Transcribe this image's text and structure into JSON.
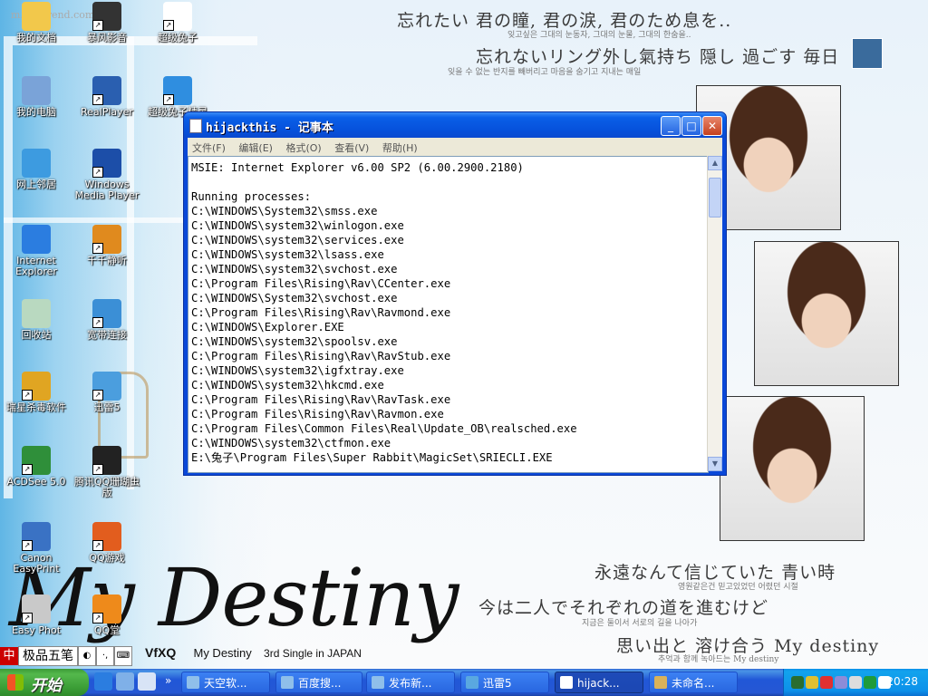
{
  "desktop": {
    "icons": [
      {
        "label": "我的文档",
        "glyph": "my-documents-icon",
        "color": "#f2c84b",
        "shortcut": false
      },
      {
        "label": "暴风影音",
        "glyph": "baofeng-player-icon",
        "color": "#333333",
        "shortcut": true
      },
      {
        "label": "超级兔子",
        "glyph": "super-rabbit-icon",
        "color": "#ffffff",
        "shortcut": true
      },
      {
        "label": "我的电脑",
        "glyph": "my-computer-icon",
        "color": "#7aa3d8",
        "shortcut": false
      },
      {
        "label": "RealPlayer",
        "glyph": "realplayer-icon",
        "color": "#2a5fb0",
        "shortcut": true
      },
      {
        "label": "超级兔子精灵",
        "glyph": "super-rabbit-sprite-icon",
        "color": "#2f8ee0",
        "shortcut": true
      },
      {
        "label": "网上邻居",
        "glyph": "network-places-icon",
        "color": "#3d9be0",
        "shortcut": false
      },
      {
        "label": "Windows Media Player",
        "glyph": "windows-media-player-icon",
        "color": "#1c4ea8",
        "shortcut": true
      },
      {
        "label": "Internet Explorer",
        "glyph": "internet-explorer-icon",
        "color": "#2b7de0",
        "shortcut": false
      },
      {
        "label": "千千静听",
        "glyph": "ttplayer-icon",
        "color": "#e08a1e",
        "shortcut": true
      },
      {
        "label": "回收站",
        "glyph": "recycle-bin-icon",
        "color": "#b9d9c0",
        "shortcut": false
      },
      {
        "label": "宽带连接",
        "glyph": "broadband-connection-icon",
        "color": "#3b8fd6",
        "shortcut": true
      },
      {
        "label": "瑞星杀毒软件",
        "glyph": "rising-antivirus-icon",
        "color": "#e0a522",
        "shortcut": true
      },
      {
        "label": "迅雷5",
        "glyph": "thunder-icon",
        "color": "#4b9ede",
        "shortcut": true
      },
      {
        "label": "ACDSee 5.0",
        "glyph": "acdsee-icon",
        "color": "#2f8f3a",
        "shortcut": true
      },
      {
        "label": "腾讯QQ珊瑚虫版",
        "glyph": "qq-icon",
        "color": "#222222",
        "shortcut": true
      },
      {
        "label": "Canon EasyPrint",
        "glyph": "canon-icon",
        "color": "#3a72c4",
        "shortcut": true
      },
      {
        "label": "QQ游戏",
        "glyph": "qq-game-icon",
        "color": "#e25d1e",
        "shortcut": true
      },
      {
        "label": "Easy Phot",
        "glyph": "easy-photo-icon",
        "color": "#c9c9c9",
        "shortcut": true
      },
      {
        "label": "QQ堂",
        "glyph": "qq-tang-icon",
        "color": "#ee8a1b",
        "shortcut": true
      }
    ]
  },
  "wallpaper": {
    "watermark": "m.woyirend.com",
    "lines": [
      "忘れたい 君の瞳, 君の涙, 君のため息を..",
      "잊고싶은 그대의 눈동자, 그대의 눈물, 그대의 한숨을..",
      "忘れないリング外し氣持ち 隠し 過ごす 毎日",
      "잊을 수 없는 반지를 빼버리고 마음을 숨기고 지내는 매일",
      "永遠なんて信じていた 青い時",
      "영원같은건 믿고있었던 어렸던 시절",
      "今は二人でそれぞれの道を進むけど",
      "지금은 둘이서 서로의 길을 나아가",
      "思い出と 溶け合う  My destiny",
      "추억과 함께 녹아드는 My destiny"
    ],
    "logo_text": "My Destiny",
    "brand": "VfXQ",
    "album_title": "My Destiny",
    "album_sub": "3rd Single in JAPAN"
  },
  "ime": {
    "name": "极品五笔",
    "logo": "中",
    "btns": [
      "◐",
      "·,",
      "⌨"
    ]
  },
  "notepad": {
    "title": "hijackthis - 记事本",
    "menu": [
      "文件(F)",
      "编辑(E)",
      "格式(O)",
      "查看(V)",
      "帮助(H)"
    ],
    "lines": [
      "MSIE: Internet Explorer v6.00 SP2 (6.00.2900.2180)",
      "",
      "Running processes:",
      "C:\\WINDOWS\\System32\\smss.exe",
      "C:\\WINDOWS\\system32\\winlogon.exe",
      "C:\\WINDOWS\\system32\\services.exe",
      "C:\\WINDOWS\\system32\\lsass.exe",
      "C:\\WINDOWS\\system32\\svchost.exe",
      "C:\\Program Files\\Rising\\Rav\\CCenter.exe",
      "C:\\WINDOWS\\System32\\svchost.exe",
      "C:\\Program Files\\Rising\\Rav\\Ravmond.exe",
      "C:\\WINDOWS\\Explorer.EXE",
      "C:\\WINDOWS\\system32\\spoolsv.exe",
      "C:\\Program Files\\Rising\\Rav\\RavStub.exe",
      "C:\\WINDOWS\\system32\\igfxtray.exe",
      "C:\\WINDOWS\\system32\\hkcmd.exe",
      "C:\\Program Files\\Rising\\Rav\\RavTask.exe",
      "C:\\Program Files\\Rising\\Rav\\Ravmon.exe",
      "C:\\Program Files\\Common Files\\Real\\Update_OB\\realsched.exe",
      "C:\\WINDOWS\\system32\\ctfmon.exe",
      "E:\\兔子\\Program Files\\Super Rabbit\\MagicSet\\SRIECLI.EXE"
    ]
  },
  "taskbar": {
    "start_label": "开始",
    "overflow": "»",
    "quick_launch": [
      {
        "name": "ie-quicklaunch-icon",
        "color": "#2b7de0"
      },
      {
        "name": "show-desktop-icon",
        "color": "#7fb0e8"
      },
      {
        "name": "media-quicklaunch-icon",
        "color": "#d8e4f6"
      }
    ],
    "tasks": [
      {
        "label": "天空软...",
        "color": "#8fbfea",
        "active": false
      },
      {
        "label": "百度搜...",
        "color": "#8fbfea",
        "active": false
      },
      {
        "label": "发布新...",
        "color": "#8fbfea",
        "active": false
      },
      {
        "label": "迅雷5",
        "color": "#5aa8e0",
        "active": false
      },
      {
        "label": "hijack...",
        "color": "#ffffff",
        "active": true
      },
      {
        "label": "未命名...",
        "color": "#d9b25a",
        "active": false
      }
    ],
    "tray_icons": [
      "#2a6d2f",
      "#e0c030",
      "#e03030",
      "#8c8cd8",
      "#dddddd",
      "#1f9b3b",
      "#ffffff"
    ],
    "clock": "20:28"
  }
}
